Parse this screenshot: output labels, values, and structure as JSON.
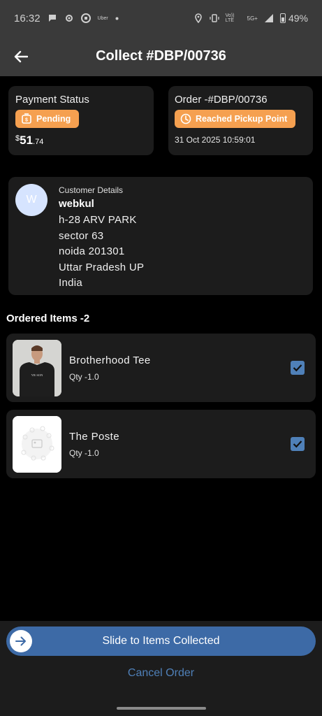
{
  "status_bar": {
    "time": "16:32",
    "uber_label": "Uber",
    "net_small_top": "Vo)) LTE",
    "net_type": "5G+",
    "battery": "49%"
  },
  "app_bar": {
    "title": "Collect #DBP/00736",
    "back_icon": "arrow-left-icon"
  },
  "payment": {
    "label": "Payment Status",
    "status": "Pending",
    "status_icon": "cash-icon",
    "currency": "$",
    "amount_whole": "51",
    "amount_decimal": ".74",
    "pill_color": "#f5a050"
  },
  "order": {
    "label": "Order -#DBP/00736",
    "status": "Reached Pickup Point",
    "status_icon": "clock-icon",
    "date": "31 Oct 2025 10:59:01"
  },
  "customer": {
    "avatar_letter": "W",
    "label": "Customer Details",
    "name": "webkul",
    "address_lines": [
      "h-28 ARV PARK",
      "sector 63",
      "noida 201301",
      "Uttar Pradesh UP",
      "India"
    ]
  },
  "ordered_items": {
    "title": "Ordered Items -2",
    "items": [
      {
        "name": "Brotherhood Tee",
        "qty": "Qty  -1.0",
        "checked": true,
        "thumb_icon": "t-shirt-icon"
      },
      {
        "name": "The Poste",
        "qty": "Qty  -1.0",
        "checked": true,
        "thumb_icon": "placeholder-image-icon"
      }
    ]
  },
  "actions": {
    "slide_label": "Slide to Items Collected",
    "cancel_label": "Cancel Order",
    "accent": "#3d6aa6"
  }
}
